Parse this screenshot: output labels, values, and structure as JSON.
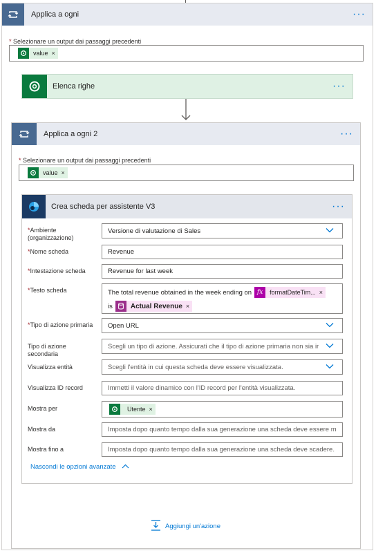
{
  "outer_loop": {
    "title": "Applica a ogni",
    "output_label": "Selezionare un output dai passaggi precedenti",
    "token": "value"
  },
  "list_rows": {
    "title": "Elenca righe"
  },
  "inner_loop": {
    "title": "Applica a ogni 2",
    "output_label": "Selezionare un output dai passaggi precedenti",
    "token": "value"
  },
  "card_action": {
    "title": "Crea scheda per assistente V3",
    "fields": {
      "environment": {
        "label": "Ambiente (organizzazione)",
        "value": "Versione di valutazione di Sales"
      },
      "card_name": {
        "label": "Nome scheda",
        "value": "Revenue"
      },
      "card_header": {
        "label": "Intestazione scheda",
        "value": "Revenue for last week"
      },
      "card_text": {
        "label": "Testo scheda",
        "prefix": "The total revenue obtained in the week ending on",
        "token1": "formatDateTim...",
        "middle": "is",
        "token2": "Actual Revenue"
      },
      "primary_action": {
        "label": "Tipo di azione primaria",
        "value": "Open URL"
      },
      "secondary_action": {
        "label": "Tipo di azione secondaria",
        "placeholder": "Scegli un tipo di azione. Assicurati che il tipo di azione primaria non sia ir"
      },
      "show_entity": {
        "label": "Visualizza entità",
        "placeholder": "Scegli l'entità in cui questa scheda deve essere visualizzata."
      },
      "show_record_id": {
        "label": "Visualizza ID record",
        "placeholder": "Immetti il valore dinamico con l'ID record per l'entità visualizzata."
      },
      "show_for": {
        "label": "Mostra per",
        "token": "Utente"
      },
      "show_from": {
        "label": "Mostra da",
        "placeholder": "Imposta dopo quanto tempo dalla sua generazione una scheda deve essere mo"
      },
      "show_until": {
        "label": "Mostra fino a",
        "placeholder": "Imposta dopo quanto tempo dalla sua generazione una scheda deve scadere. I"
      }
    },
    "advanced_toggle": "Nascondi le opzioni avanzate"
  },
  "add_action": "Aggiungi un'azione",
  "colors": {
    "loop_icon": "#486991",
    "loop_header": "#e7eaf1",
    "dataverse_green": "#0a7a3e",
    "list_rows_header": "#dff1e4",
    "card_header": "#e3e6ec",
    "link_blue": "#0078d4",
    "required_red": "#a4262c"
  },
  "icons": [
    "loop-icon",
    "dataverse-icon",
    "assistant-icon",
    "function-icon",
    "database-icon",
    "chevron-down-icon",
    "chevron-up-icon",
    "more-options-icon",
    "close-icon",
    "arrow-down-icon",
    "add-action-icon"
  ]
}
